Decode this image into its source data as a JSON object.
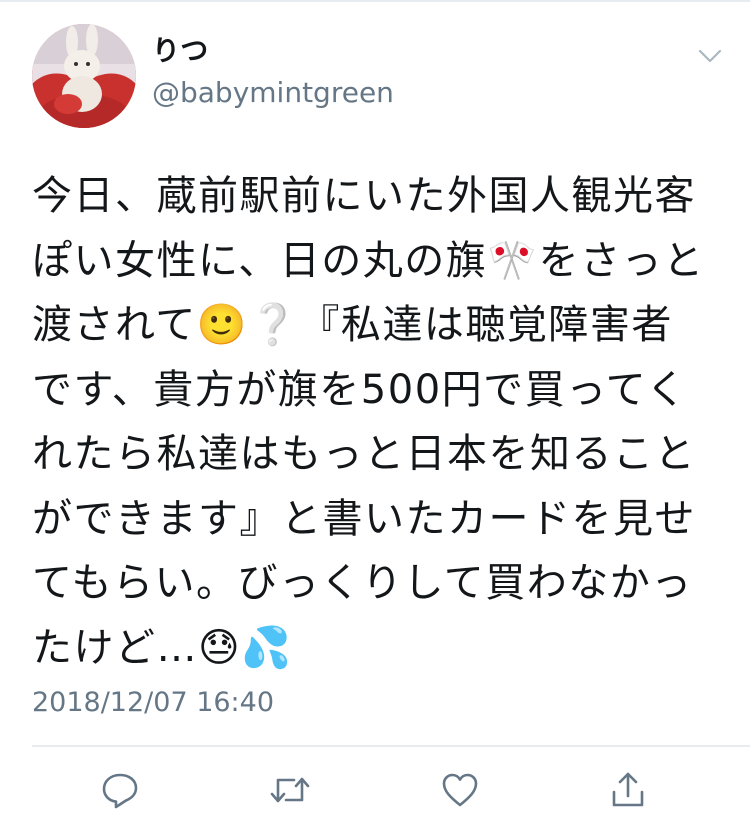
{
  "tweet": {
    "display_name": "りつ",
    "handle": "@babymintgreen",
    "text": "今日、蔵前駅前にいた外国人観光客ぽい女性に、日の丸の旗🎌をさっと渡されて🙂❔『私達は聴覚障害者です、貴方が旗を500円で買ってくれたら私達はもっと日本を知ることができます』と書いたカードを見せてもらい。びっくりして買わなかったけど…😓💦",
    "timestamp": "2018/12/07 16:40"
  },
  "icons": {
    "menu": "chevron-down-icon",
    "reply": "reply-icon",
    "retweet": "retweet-icon",
    "like": "heart-icon",
    "share": "share-icon"
  },
  "colors": {
    "text": "#14171a",
    "secondary": "#657786",
    "divider": "#e6ecf0",
    "accent": "#1da1f2"
  }
}
